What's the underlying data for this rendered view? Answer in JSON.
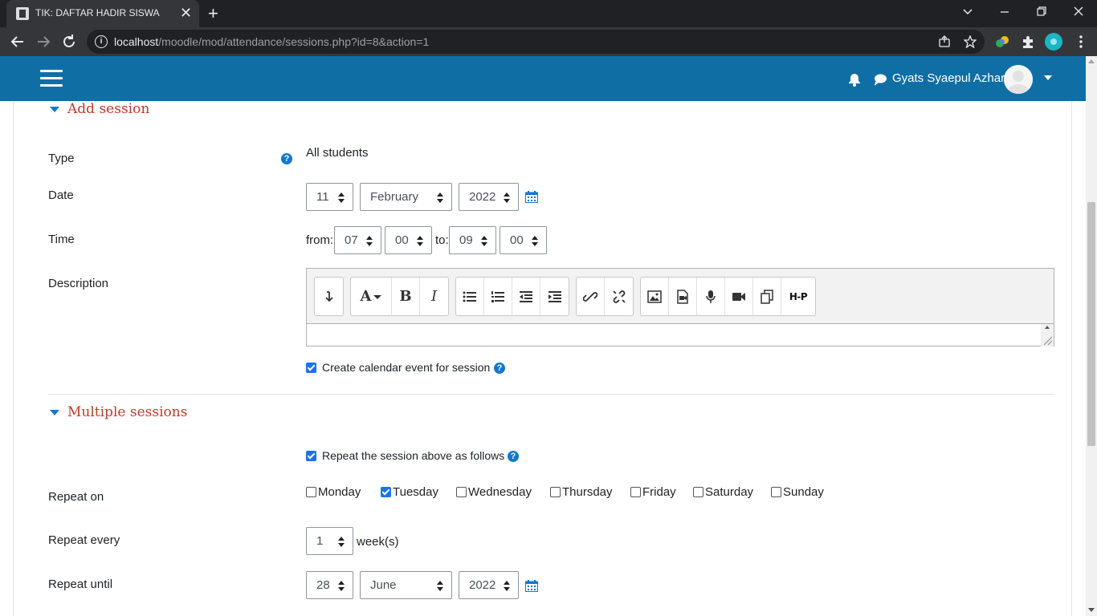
{
  "browser": {
    "tab_title": "TIK: DAFTAR HADIR SISWA",
    "tab_close": "✕",
    "new_tab": "+",
    "url_host": "localhost",
    "url_path": "/moodle/mod/attendance/sessions.php?id=8&action=1"
  },
  "navbar": {
    "user_name": "Gyats Syaepul Azhar"
  },
  "add_session": {
    "title": "Add session",
    "type_label": "Type",
    "type_value": "All students",
    "date_label": "Date",
    "date_day": "11",
    "date_month": "February",
    "date_year": "2022",
    "time_label": "Time",
    "from_label": "from:",
    "from_hour": "07",
    "from_minute": "00",
    "to_label": "to:",
    "to_hour": "09",
    "to_minute": "00",
    "description_label": "Description",
    "calendar_event_label": "Create calendar event for session"
  },
  "multiple_sessions": {
    "title": "Multiple sessions",
    "repeat_label": "Repeat the session above as follows",
    "repeat_on_label": "Repeat on",
    "days": [
      {
        "name": "Monday",
        "checked": false
      },
      {
        "name": "Tuesday",
        "checked": true
      },
      {
        "name": "Wednesday",
        "checked": false
      },
      {
        "name": "Thursday",
        "checked": false
      },
      {
        "name": "Friday",
        "checked": false
      },
      {
        "name": "Saturday",
        "checked": false
      },
      {
        "name": "Sunday",
        "checked": false
      }
    ],
    "repeat_every_label": "Repeat every",
    "repeat_every_value": "1",
    "repeat_every_unit": "week(s)",
    "repeat_until_label": "Repeat until",
    "until_day": "28",
    "until_month": "June",
    "until_year": "2022"
  },
  "editor_buttons": [
    "expand-icon",
    "font-style-icon",
    "bold-icon",
    "italic-icon",
    "unordered-list-icon",
    "ordered-list-icon",
    "outdent-icon",
    "indent-icon",
    "link-icon",
    "unlink-icon",
    "image-icon",
    "media-icon",
    "record-audio-icon",
    "record-video-icon",
    "manage-files-icon",
    "h5p-icon"
  ],
  "editor_text": {
    "bold": "B",
    "italic": "I",
    "font": "A",
    "h5p": "H-P"
  },
  "colors": {
    "navbar": "#0f6fa5",
    "section_title": "#c0392b",
    "accent": "#1177d1"
  }
}
